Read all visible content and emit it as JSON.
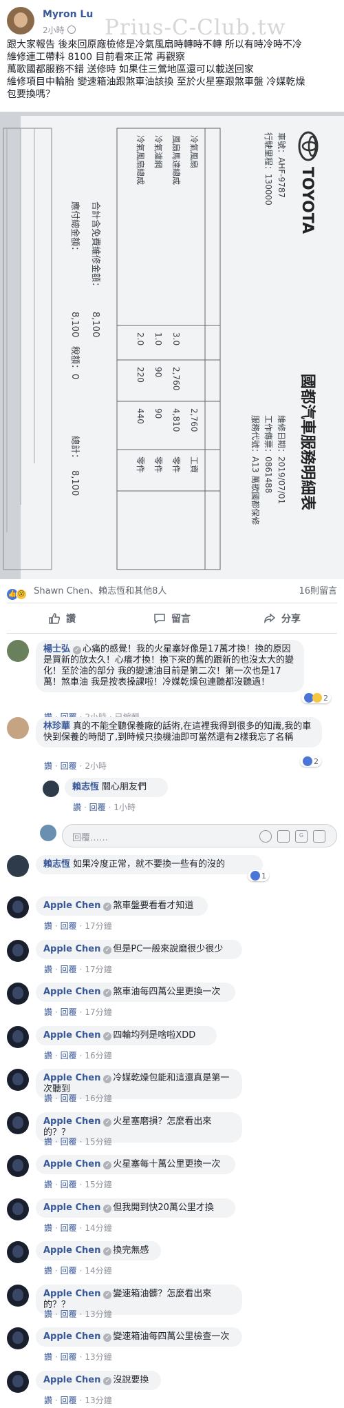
{
  "watermark": "Prius-C-Club.tw",
  "post": {
    "author": "Myron Lu",
    "time": "2小時",
    "lines": [
      "跟大家報告 後來回原廠檢修是冷氣風扇時轉時不轉 所以有時冷時不冷",
      "維修連工帶料 8100 目前看來正常 再觀察",
      "萬歌國都服務不錯 送修時 如果住三鶯地區還可以載送回家",
      "維修項目中輪胎 變速箱油跟煞車油該換 至於火星塞跟煞車盤 冷媒乾燥",
      "包要換嗎？"
    ]
  },
  "receipt": {
    "brand": "TOYOTA",
    "title": "國都汽車服務明細表",
    "plate_label": "車號：AHF-9787",
    "mileage_label": "行駛里程：130000",
    "date_label": "維修日期：2019/07/01",
    "work_order": "工作傳票：0861488",
    "service_name": "服務代號：A13 萬歌國都保修",
    "rows": [
      {
        "item": "冷氣風扇",
        "qty": "",
        "price": "",
        "total": "2,760",
        "kind": "工資"
      },
      {
        "item": "風扇馬達總成",
        "qty": "3.0",
        "price": "2,760",
        "total": "4,810",
        "kind": "零件"
      },
      {
        "item": "冷氣濾網",
        "qty": "1.0",
        "price": "90",
        "total": "90",
        "kind": "零件"
      },
      {
        "item": "冷氣風扇總成",
        "qty": "2.0",
        "price": "220",
        "total": "440",
        "kind": "零件"
      }
    ],
    "subtotal_label": "合計含免費維修金額：",
    "subtotal": "8,100",
    "total_label": "應付總金額：",
    "total": "8,100",
    "tax_label": "稅額：",
    "tax": "0",
    "grand_label": "總計：",
    "grand": "8,100"
  },
  "reactions": {
    "names": "Shawn Chen、賴志恆和其他8人",
    "comment_count": "16則留言"
  },
  "actions": {
    "like": "讚",
    "comment": "留言",
    "share": "分享"
  },
  "comments": [
    {
      "name": "楊士弘",
      "text": "心痛的感覺！我的火星塞好像是17萬才換！換的原因是買新的放太久！心癢才換！換下來的舊的跟新的也沒太大的變化！至於油的部分 我的變速油目前是第二次！第一次也是17萬！煞車油 我是按表操課啦！冷媒乾燥包連聽都沒聽過！",
      "like": "讚",
      "reply": "回覆",
      "time": "2小時",
      "edited": "已編輯",
      "react_count": "2"
    },
    {
      "name": "林珍華",
      "text": "真的不能全聽保養廠的話術,在這裡我得到很多的知識,我的車快到保養的時間了,到時候只換機油即可當然還有2樣我忘了名稱",
      "like": "讚",
      "reply": "回覆",
      "time": "2小時",
      "react_count": "2"
    },
    {
      "name": "賴志恆",
      "text": "關心朋友們",
      "like": "讚",
      "reply": "回覆",
      "time": "1小時"
    }
  ],
  "input_placeholder": "回覆……",
  "comment2": {
    "name": "賴志恆",
    "text": "如果冷度正常，就不要換一些有的沒的",
    "react_count": "1"
  },
  "apple_name": "Apple Chen",
  "apple_comments": [
    {
      "text": "煞車盤要看看才知道",
      "time": "17分鐘"
    },
    {
      "text": "但是PC一般來說磨很少很少",
      "time": "17分鐘"
    },
    {
      "text": "煞車油每四萬公里更換一次",
      "time": "17分鐘"
    },
    {
      "text": "四輪均列是啥啦XDD",
      "time": "16分鐘"
    },
    {
      "text": "冷媒乾燥包能和這還真是第一次聽到",
      "time": "16分鐘"
    },
    {
      "text": "火星塞磨損？怎麼看出來的？？",
      "time": "15分鐘"
    },
    {
      "text": "火星塞每十萬公里更換一次",
      "time": "15分鐘"
    },
    {
      "text": "但我開到快20萬公里才換",
      "time": "14分鐘"
    },
    {
      "text": "換完無感",
      "time": "14分鐘"
    },
    {
      "text": "變速箱油髒？怎麼看出來的？？",
      "time": "13分鐘"
    },
    {
      "text": "變速箱油每四萬公里檢查一次",
      "time": "13分鐘"
    },
    {
      "text": "沒說要換",
      "time": "13分鐘"
    }
  ],
  "meta_like": "讚",
  "meta_reply": "回覆"
}
